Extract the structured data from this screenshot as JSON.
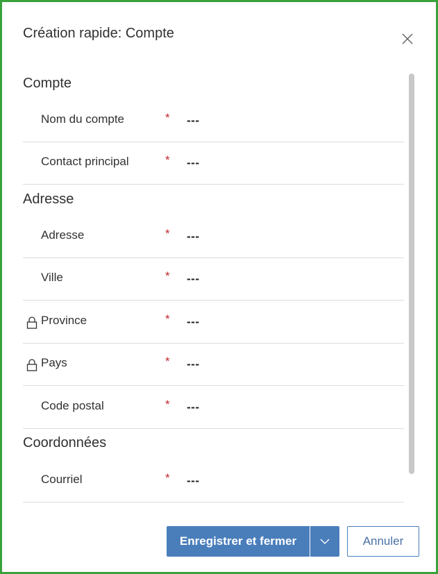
{
  "dialog": {
    "title": "Création rapide: Compte"
  },
  "sections": {
    "compte": {
      "title": "Compte",
      "fields": [
        {
          "label": "Nom du compte",
          "required": "*",
          "value": "---"
        },
        {
          "label": "Contact principal",
          "required": "*",
          "value": "---"
        }
      ]
    },
    "adresse": {
      "title": "Adresse",
      "fields": [
        {
          "label": "Adresse",
          "required": "*",
          "value": "---"
        },
        {
          "label": "Ville",
          "required": "*",
          "value": "---"
        },
        {
          "label": "Province",
          "required": "*",
          "value": "---",
          "locked": true
        },
        {
          "label": "Pays",
          "required": "*",
          "value": "---",
          "locked": true
        },
        {
          "label": "Code postal",
          "required": "*",
          "value": "---"
        }
      ]
    },
    "coordonnees": {
      "title": "Coordonnées",
      "fields": [
        {
          "label": "Courriel",
          "required": "*",
          "value": "---"
        }
      ]
    }
  },
  "footer": {
    "save_close_label": "Enregistrer et fermer",
    "cancel_label": "Annuler"
  },
  "icons": {
    "close": "close-icon",
    "lock": "lock-icon",
    "chevron": "chevron-down-icon"
  },
  "colors": {
    "primary": "#4a7ebb",
    "required": "#c4262e",
    "frame": "#3aa23a"
  }
}
